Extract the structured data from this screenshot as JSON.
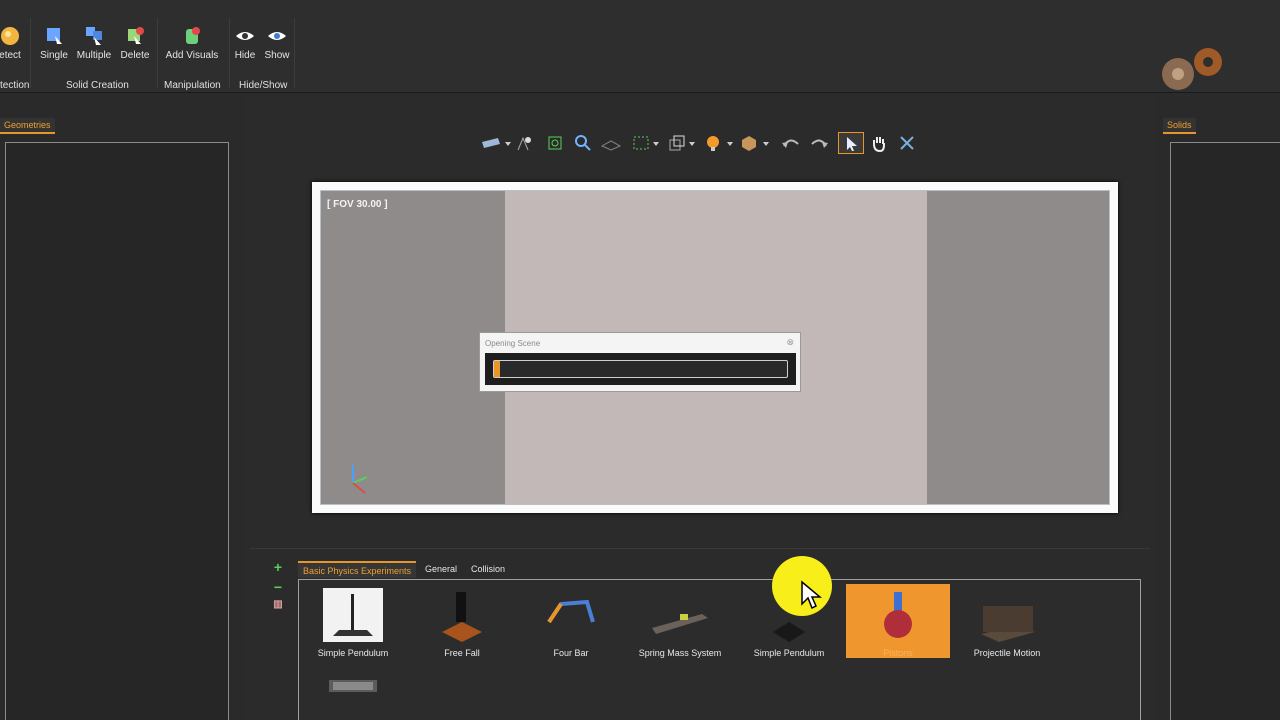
{
  "ribbon": {
    "buttons": [
      {
        "label": "etect",
        "icon": "detect-icon"
      },
      {
        "label": "Single",
        "icon": "single-solid-icon"
      },
      {
        "label": "Multiple",
        "icon": "multiple-solid-icon"
      },
      {
        "label": "Delete",
        "icon": "delete-solid-icon"
      },
      {
        "label": "Add Visuals",
        "icon": "add-visuals-icon"
      },
      {
        "label": "Hide",
        "icon": "eye-icon"
      },
      {
        "label": "Show",
        "icon": "eye-icon"
      }
    ],
    "groups": [
      "tection",
      "Solid Creation",
      "Manipulation",
      "Hide/Show"
    ]
  },
  "left_panel": {
    "tab": "Geometries"
  },
  "right_panel": {
    "tab": "Solids"
  },
  "viewport": {
    "fov_label": "[ FOV 30.00 ]",
    "dialog": {
      "title": "Opening Scene",
      "close": "⊗",
      "progress": 0.01
    }
  },
  "library": {
    "tools": [
      "+",
      "−",
      "▥"
    ],
    "tabs": [
      {
        "label": "Basic Physics Experiments",
        "active": true
      },
      {
        "label": "General",
        "active": false
      },
      {
        "label": "Collision",
        "active": false
      }
    ],
    "items": [
      {
        "label": "Simple Pendulum"
      },
      {
        "label": "Free Fall"
      },
      {
        "label": "Four Bar"
      },
      {
        "label": "Spring Mass System"
      },
      {
        "label": "Simple Pendulum"
      },
      {
        "label": "Pistons",
        "selected": true
      },
      {
        "label": "Projectile Motion"
      }
    ]
  },
  "colors": {
    "accent": "#e8962a",
    "background": "#2b2b2b",
    "highlight": "#f7ee1a"
  }
}
